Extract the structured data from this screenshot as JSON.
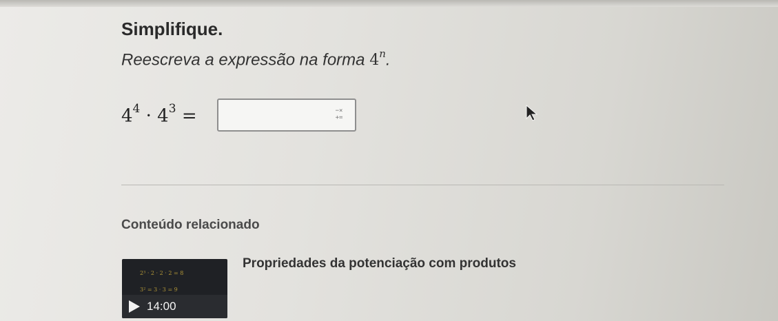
{
  "exercise": {
    "title": "Simplifique.",
    "instruction_text": "Reescreva a expressão na forma ",
    "instruction_base": "4",
    "instruction_exponent": "n",
    "instruction_end": ".",
    "expression": {
      "base1": "4",
      "exp1": "4",
      "operator": "·",
      "base2": "4",
      "exp2": "3",
      "equals": "="
    },
    "answer_input": {
      "value": "",
      "keyboard_icon": "math-keyboard-icon",
      "keyboard_icon_top": "−×",
      "keyboard_icon_bottom": "+="
    }
  },
  "cursor": {
    "icon": "mouse-pointer-icon"
  },
  "related": {
    "heading": "Conteúdo relacionado",
    "video": {
      "title": "Propriedades da potenciação com produtos",
      "duration": "14:00",
      "play_icon": "play-icon",
      "thumbnail_line1": "2³ · 2 · 2 · 2 = 8",
      "thumbnail_line2": "3² = 3 · 3 = 9"
    }
  }
}
